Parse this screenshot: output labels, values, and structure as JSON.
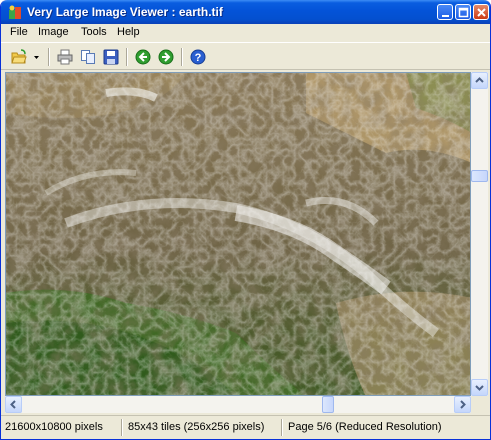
{
  "window": {
    "title": "Very Large Image Viewer : earth.tif"
  },
  "menu": [
    "File",
    "Image",
    "Tools",
    "Help"
  ],
  "toolbar": {
    "icons": [
      "open-folder-icon",
      "dropdown-arrow-icon",
      "print-icon",
      "copy-icon",
      "save-icon",
      "back-icon",
      "forward-icon",
      "help-icon"
    ]
  },
  "image": {
    "file": "earth.tif"
  },
  "status": {
    "dimensions": "21600x10800 pixels",
    "tiles": "85x43 tiles (256x256 pixels)",
    "page": "Page 5/6 (Reduced Resolution)"
  },
  "colors": {
    "title_blue": "#0453d8",
    "chrome": "#ece9d8",
    "accent_green": "#2f9d2f",
    "help_blue": "#2a5fd0"
  }
}
